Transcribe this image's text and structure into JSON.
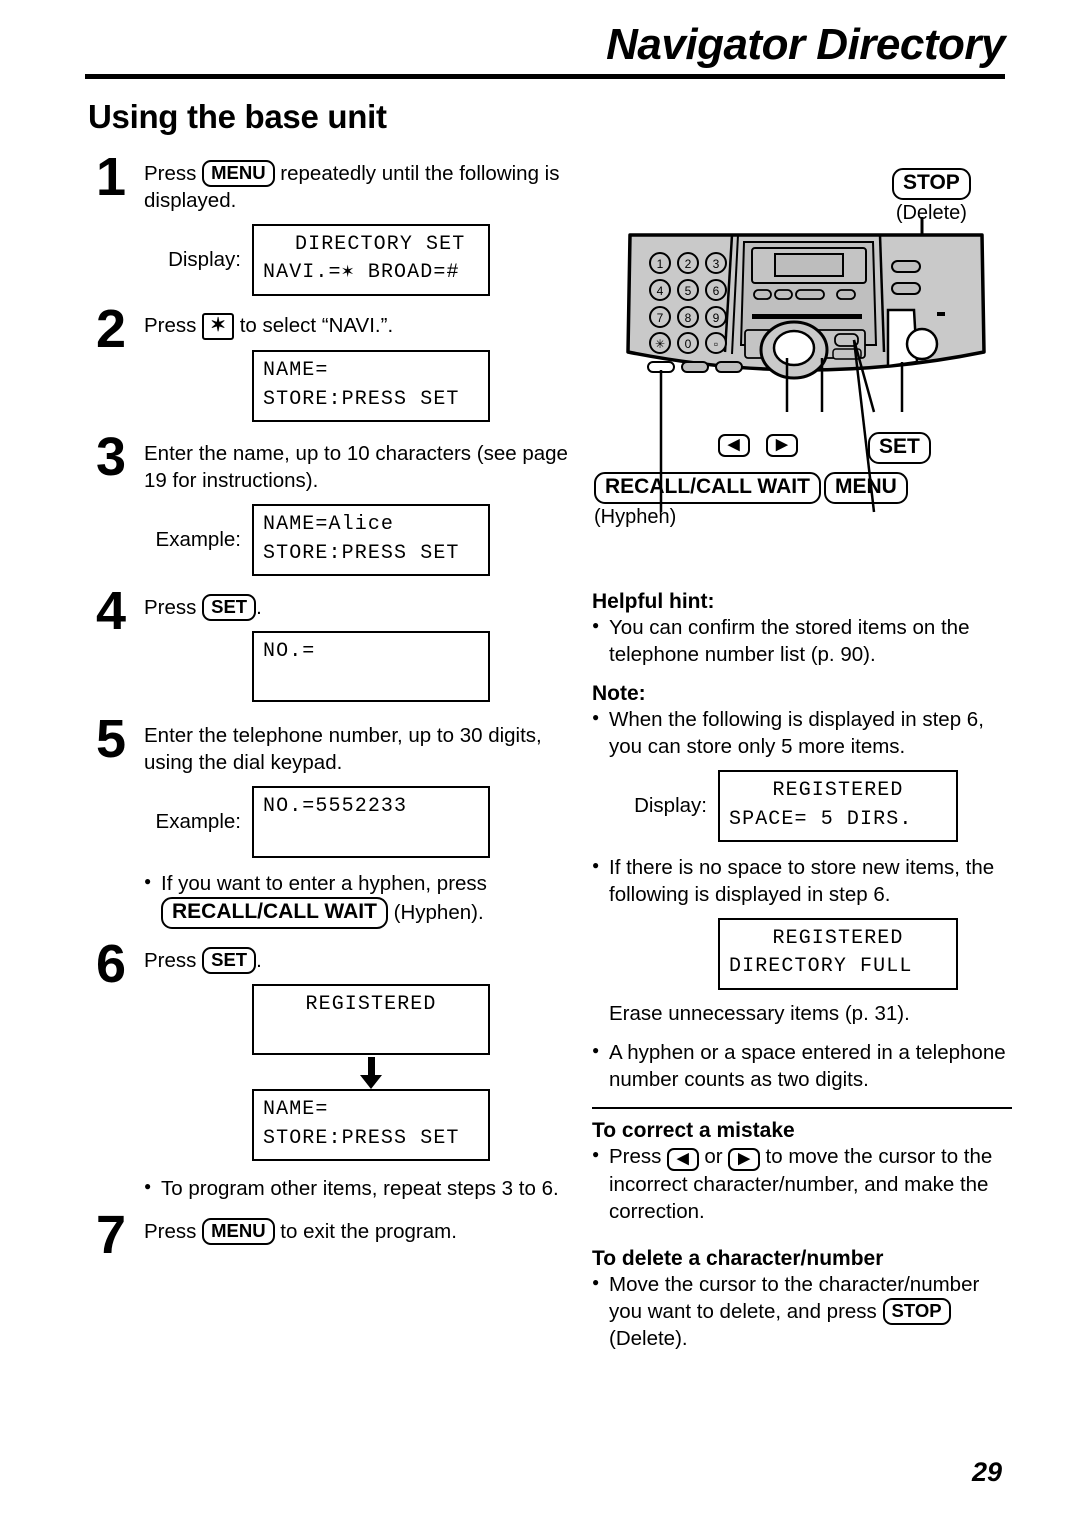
{
  "header": {
    "title": "Navigator Directory",
    "section_title": "Using the base unit"
  },
  "page_number": "29",
  "steps": [
    {
      "num": "1",
      "text_before_key": "Press",
      "key": "MENU",
      "text_after_key": "repeatedly until the following is displayed.",
      "display_label": "Display:",
      "lcd_line1": "DIRECTORY SET",
      "lcd_line2": "NAVI.=✶ BROAD=#"
    },
    {
      "num": "2",
      "text_before_key": "Press",
      "key": "✶",
      "text_after_key": "to select “NAVI.”.",
      "lcd_line1": "NAME=",
      "lcd_line2": "STORE:PRESS SET"
    },
    {
      "num": "3",
      "text": "Enter the name, up to 10 characters (see page 19 for instructions).",
      "display_label": "Example:",
      "lcd_line1": "NAME=Alice",
      "lcd_line2": "STORE:PRESS SET"
    },
    {
      "num": "4",
      "text_before_key": "Press",
      "key": "SET",
      "text_after_key": ".",
      "lcd_line1": "NO.=",
      "lcd_line2": ""
    },
    {
      "num": "5",
      "text": "Enter the telephone number, up to 30 digits, using the dial keypad.",
      "display_label": "Example:",
      "lcd_line1": "NO.=5552233",
      "lcd_line2": "",
      "bullet_before": "If you want to enter a hyphen, press",
      "bullet_key": "RECALL/CALL WAIT",
      "bullet_after": "(Hyphen)."
    },
    {
      "num": "6",
      "text_before_key": "Press",
      "key": "SET",
      "text_after_key": ".",
      "lcd1_line1": "REGISTERED",
      "lcd1_line2": "",
      "lcd2_line1": "NAME=",
      "lcd2_line2": "STORE:PRESS SET",
      "bullet_after_all": "To program other items, repeat steps 3 to 6."
    },
    {
      "num": "7",
      "text_before_key": "Press",
      "key": "MENU",
      "text_after_key": "to exit the program."
    }
  ],
  "device": {
    "stop_key": "STOP",
    "stop_sub": "(Delete)",
    "left_arrow_key": "◀",
    "right_arrow_key": "▶",
    "set_key": "SET",
    "recall_key": "RECALL/CALL WAIT",
    "recall_sub": "(Hyphen)",
    "menu_key": "MENU",
    "keypad": [
      "1",
      "2",
      "3",
      "4",
      "5",
      "6",
      "7",
      "8",
      "9",
      "✶",
      "0",
      "□"
    ]
  },
  "right_column": {
    "helpful_hint_head": "Helpful hint:",
    "helpful_hint_bullet": "You can confirm the stored items on the telephone number list (p. 90).",
    "note_head": "Note:",
    "note_bullet_1": "When the following is displayed in step 6, you can store only 5 more items.",
    "note1_display_label": "Display:",
    "note1_lcd_line1": "REGISTERED",
    "note1_lcd_line2": "SPACE= 5 DIRS.",
    "note_bullet_2": "If there is no space to store new items, the following is displayed in step 6.",
    "note2_lcd_line1": "REGISTERED",
    "note2_lcd_line2": "DIRECTORY FULL",
    "note2_after": "Erase unnecessary items (p. 31).",
    "note_bullet_3": "A hyphen or a space entered in a telephone number counts as two digits.",
    "correct_head": "To correct a mistake",
    "correct_bullet_1": "Press",
    "correct_bullet_or": "or",
    "correct_bullet_2": "to move the cursor to the incorrect character/number, and make the correction.",
    "correct_left_key": "◀",
    "correct_right_key": "▶",
    "delete_head": "To delete a character/number",
    "delete_bullet_1": "Move the cursor to the character/number you want to delete, and press",
    "delete_key": "STOP",
    "delete_bullet_2": "(Delete)."
  }
}
